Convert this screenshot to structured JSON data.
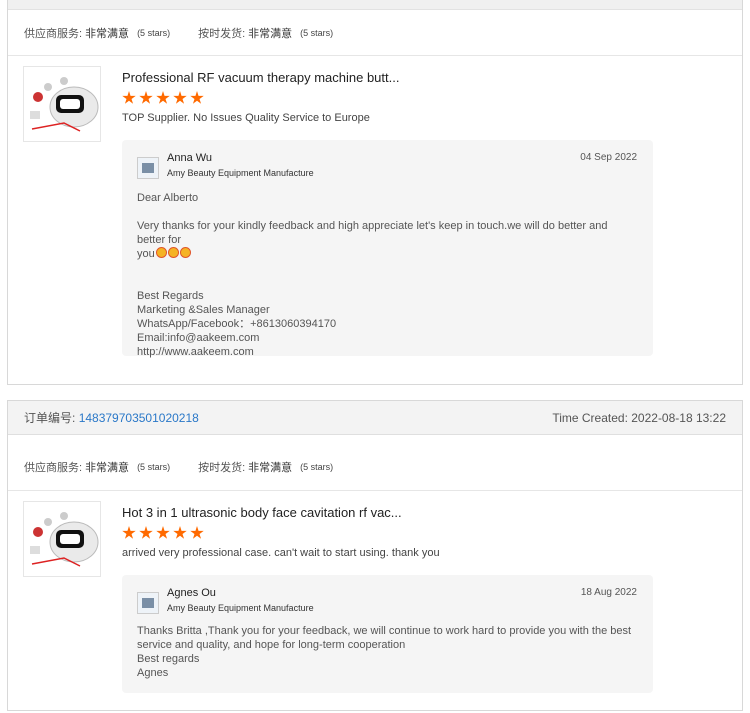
{
  "orders": [
    {
      "ratings": [
        {
          "label": "供应商服务:",
          "value": "非常满意",
          "stars": "(5 stars)"
        },
        {
          "label": "按时发货:",
          "value": "非常满意",
          "stars": "(5 stars)"
        }
      ],
      "product_title": "Professional RF vacuum therapy machine butt...",
      "rating_stars": 5,
      "review_text": "TOP Supplier. No Issues  Quality Service to Europe",
      "reply": {
        "name": "Anna Wu",
        "company": "Amy Beauty Equipment Manufacture",
        "date": "04 Sep 2022",
        "lines": [
          "Dear Alberto",
          "",
          "Very thanks for your kindly feedback and high appreciate let's keep in touch.we will do better and better for",
          "you",
          "",
          "",
          "Best Regards",
          "Marketing &Sales Manager",
          "WhatsApp/Facebook：+8613060394170",
          "Email:info@aakeem.com",
          "http://www.aakeem.com"
        ]
      }
    },
    {
      "order_label": "订单编号:",
      "order_number": "148379703501020218",
      "time_created": "Time Created: 2022-08-18 13:22",
      "ratings": [
        {
          "label": "供应商服务:",
          "value": "非常满意",
          "stars": "(5 stars)"
        },
        {
          "label": "按时发货:",
          "value": "非常满意",
          "stars": "(5 stars)"
        }
      ],
      "product_title": "Hot 3 in 1 ultrasonic body face cavitation rf vac...",
      "rating_stars": 5,
      "review_text": "arrived very professional case. can't wait to start using. thank you",
      "reply": {
        "name": "Agnes Ou",
        "company": "Amy Beauty Equipment Manufacture",
        "date": "18 Aug 2022",
        "lines": [
          "Thanks Britta ,Thank you for your feedback, we will continue to work hard to provide you with the best",
          "service and quality, and hope for long-term cooperation",
          "Best regards",
          "Agnes"
        ]
      }
    }
  ],
  "colors": {
    "star": "#ff6a00",
    "link": "#2a78c8",
    "reply_bg": "#f5f5f5"
  }
}
